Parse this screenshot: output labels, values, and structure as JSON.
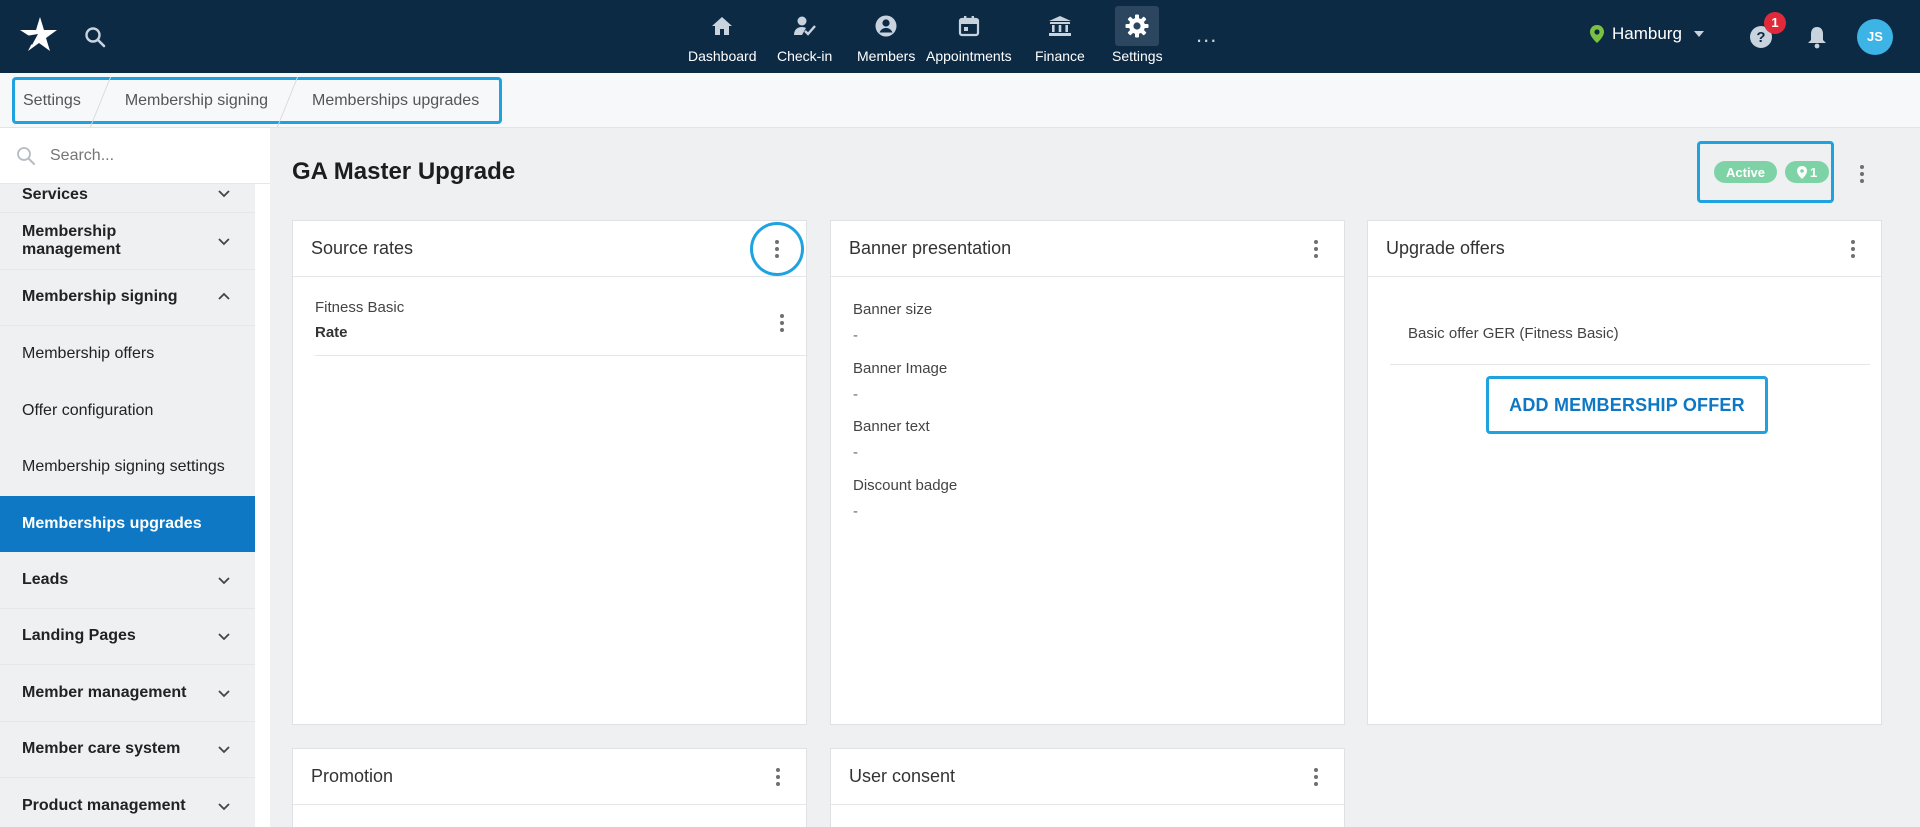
{
  "topbar": {
    "nav": [
      {
        "label": "Dashboard",
        "icon": "home-icon"
      },
      {
        "label": "Check-in",
        "icon": "checkin-icon"
      },
      {
        "label": "Members",
        "icon": "members-icon"
      },
      {
        "label": "Appointments",
        "icon": "calendar-icon"
      },
      {
        "label": "Finance",
        "icon": "bank-icon"
      },
      {
        "label": "Settings",
        "icon": "gear-icon",
        "active": true
      }
    ],
    "more": "...",
    "location": "Hamburg",
    "notifications_count": "1",
    "avatar_initials": "JS"
  },
  "breadcrumb": [
    "Settings",
    "Membership signing",
    "Memberships upgrades"
  ],
  "sidebar": {
    "search_placeholder": "Search...",
    "items": [
      {
        "label": "Services",
        "type": "group"
      },
      {
        "label": "Membership management",
        "type": "group"
      },
      {
        "label": "Membership signing",
        "type": "group",
        "expanded": true
      },
      {
        "label": "Membership offers",
        "type": "sub"
      },
      {
        "label": "Offer configuration",
        "type": "sub"
      },
      {
        "label": "Membership signing settings",
        "type": "sub"
      },
      {
        "label": "Memberships upgrades",
        "type": "sub",
        "selected": true
      },
      {
        "label": "Leads",
        "type": "group"
      },
      {
        "label": "Landing Pages",
        "type": "group"
      },
      {
        "label": "Member management",
        "type": "group"
      },
      {
        "label": "Member care system",
        "type": "group"
      },
      {
        "label": "Product management",
        "type": "group"
      }
    ]
  },
  "main": {
    "title": "GA Master Upgrade",
    "status": "Active",
    "location_count": "1",
    "cards": {
      "source_rates": {
        "title": "Source rates",
        "rate_name": "Fitness Basic",
        "rate_label": "Rate"
      },
      "banner": {
        "title": "Banner presentation",
        "fields": [
          {
            "label": "Banner size",
            "value": "-"
          },
          {
            "label": "Banner Image",
            "value": "-"
          },
          {
            "label": "Banner text",
            "value": "-"
          },
          {
            "label": "Discount badge",
            "value": "-"
          }
        ]
      },
      "upgrade_offers": {
        "title": "Upgrade offers",
        "offer": "Basic offer GER (Fitness Basic)",
        "add_button": "ADD MEMBERSHIP OFFER"
      },
      "promotion": {
        "title": "Promotion"
      },
      "user_consent": {
        "title": "User consent"
      }
    }
  },
  "colors": {
    "topbar": "#0d2a45",
    "accent": "#0f78c4",
    "highlight": "#1fa3e0",
    "status_green": "#7ed3a6",
    "badge_red": "#e02a3a"
  }
}
